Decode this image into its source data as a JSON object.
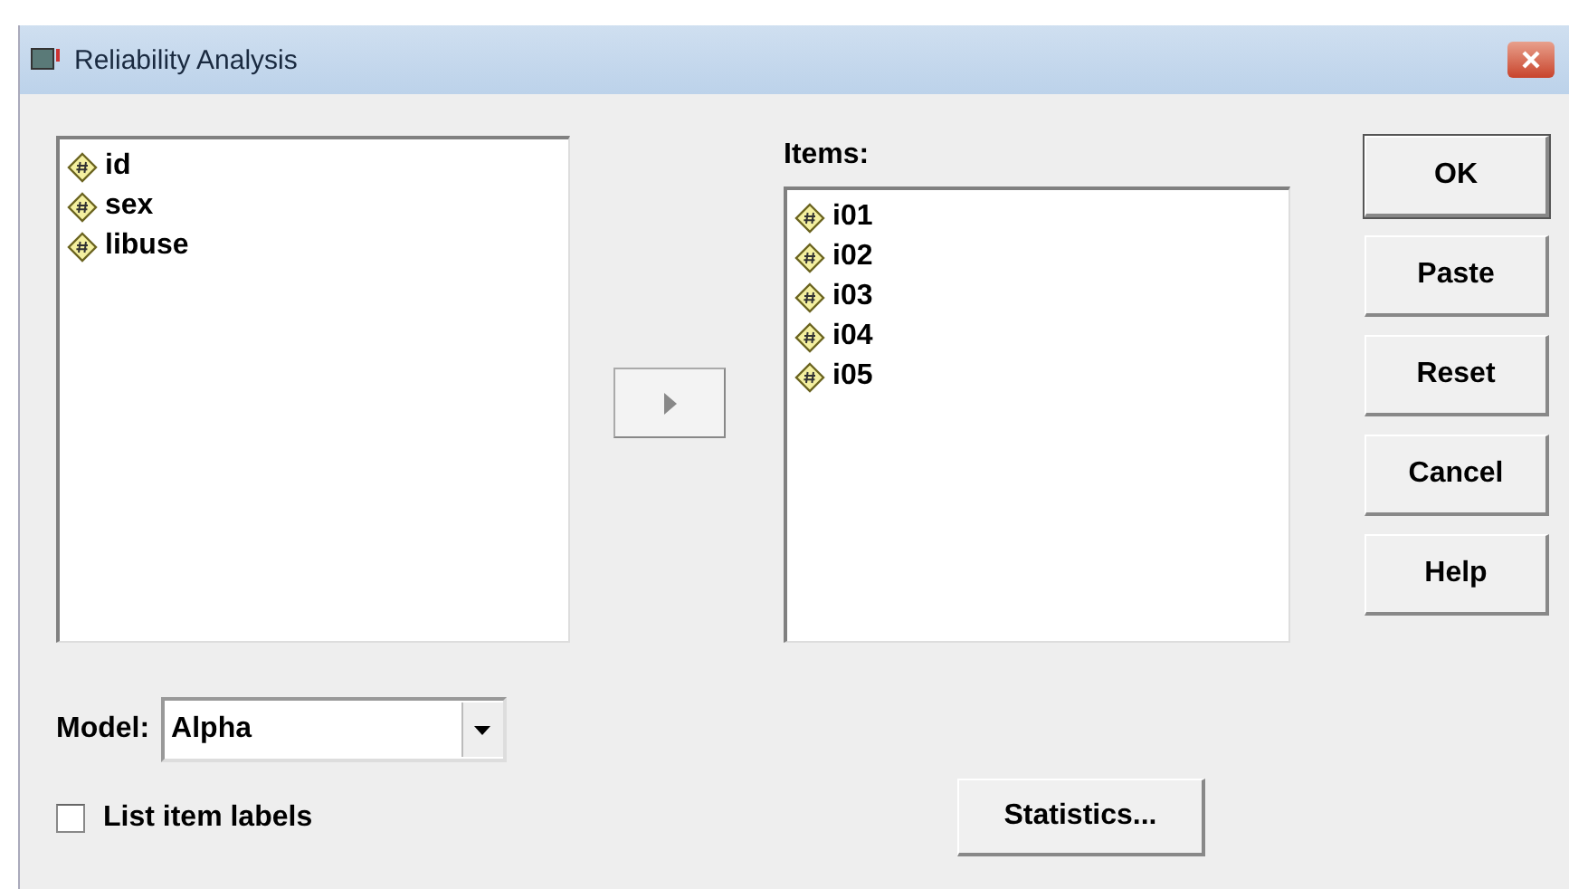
{
  "window": {
    "title": "Reliability Analysis"
  },
  "source_variables": [
    {
      "name": "id",
      "selected": false
    },
    {
      "name": "sex",
      "selected": false
    },
    {
      "name": "libuse",
      "selected": false
    }
  ],
  "items": {
    "label": "Items:",
    "variables": [
      {
        "name": "i01",
        "selected": false
      },
      {
        "name": "i02",
        "selected": false
      },
      {
        "name": "i03",
        "selected": false
      },
      {
        "name": "i04",
        "selected": false
      },
      {
        "name": "i05",
        "selected": false
      }
    ]
  },
  "buttons": [
    {
      "label": "OK",
      "kind": "default"
    },
    {
      "label": "Paste",
      "kind": "normal"
    },
    {
      "label": "Reset",
      "kind": "normal"
    },
    {
      "label": "Cancel",
      "kind": "normal"
    },
    {
      "label": "Help",
      "kind": "normal"
    }
  ],
  "model": {
    "label": "Model:",
    "value": "Alpha"
  },
  "list_item_labels": {
    "label": "List item labels",
    "checked": false
  },
  "statistics_button": {
    "label": "Statistics..."
  }
}
